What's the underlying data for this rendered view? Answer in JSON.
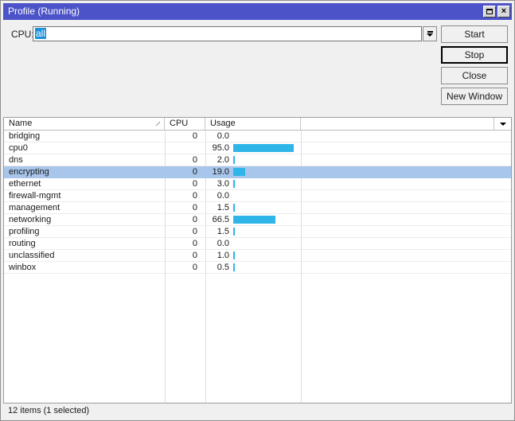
{
  "window": {
    "title": "Profile (Running)"
  },
  "toolbar": {
    "cpu_label": "CPU:",
    "cpu_value": "all",
    "buttons": [
      "Start",
      "Stop",
      "Close",
      "New Window"
    ]
  },
  "table": {
    "columns": [
      "Name",
      "CPU",
      "Usage"
    ],
    "sort": {
      "column": "Name",
      "direction": "ascending"
    },
    "rows": [
      {
        "name": "bridging",
        "cpu": "0",
        "usage": "0.0",
        "bar": 0,
        "selected": false
      },
      {
        "name": "cpu0",
        "cpu": "",
        "usage": "95.0",
        "bar": 95,
        "selected": false
      },
      {
        "name": "dns",
        "cpu": "0",
        "usage": "2.0",
        "bar": 2,
        "selected": false
      },
      {
        "name": "encrypting",
        "cpu": "0",
        "usage": "19.0",
        "bar": 19,
        "selected": true
      },
      {
        "name": "ethernet",
        "cpu": "0",
        "usage": "3.0",
        "bar": 3,
        "selected": false
      },
      {
        "name": "firewall-mgmt",
        "cpu": "0",
        "usage": "0.0",
        "bar": 0,
        "selected": false
      },
      {
        "name": "management",
        "cpu": "0",
        "usage": "1.5",
        "bar": 1.5,
        "selected": false
      },
      {
        "name": "networking",
        "cpu": "0",
        "usage": "66.5",
        "bar": 66.5,
        "selected": false
      },
      {
        "name": "profiling",
        "cpu": "0",
        "usage": "1.5",
        "bar": 1.5,
        "selected": false
      },
      {
        "name": "routing",
        "cpu": "0",
        "usage": "0.0",
        "bar": 0,
        "selected": false
      },
      {
        "name": "unclassified",
        "cpu": "0",
        "usage": "1.0",
        "bar": 1,
        "selected": false
      },
      {
        "name": "winbox",
        "cpu": "0",
        "usage": "0.5",
        "bar": 0.5,
        "selected": false
      }
    ]
  },
  "statusbar": {
    "text": "12 items (1 selected)"
  },
  "icons": {
    "maximize": "maximize-icon (outlined square)",
    "close": "close-icon (x)",
    "combo_dropdown": "dropdown-arrow-icon (bar over filled down triangle)",
    "sort": "sort-ascending-icon (diagonal tick)",
    "column_menu": "column-menu-icon (filled down triangle)"
  },
  "colors": {
    "titlebar": "#4c52c8",
    "usage_bar": "#2fb5e8",
    "row_selected": "#a8c6ec",
    "input_selection": "#1b8fd8",
    "window_bg": "#f0f0f0"
  }
}
